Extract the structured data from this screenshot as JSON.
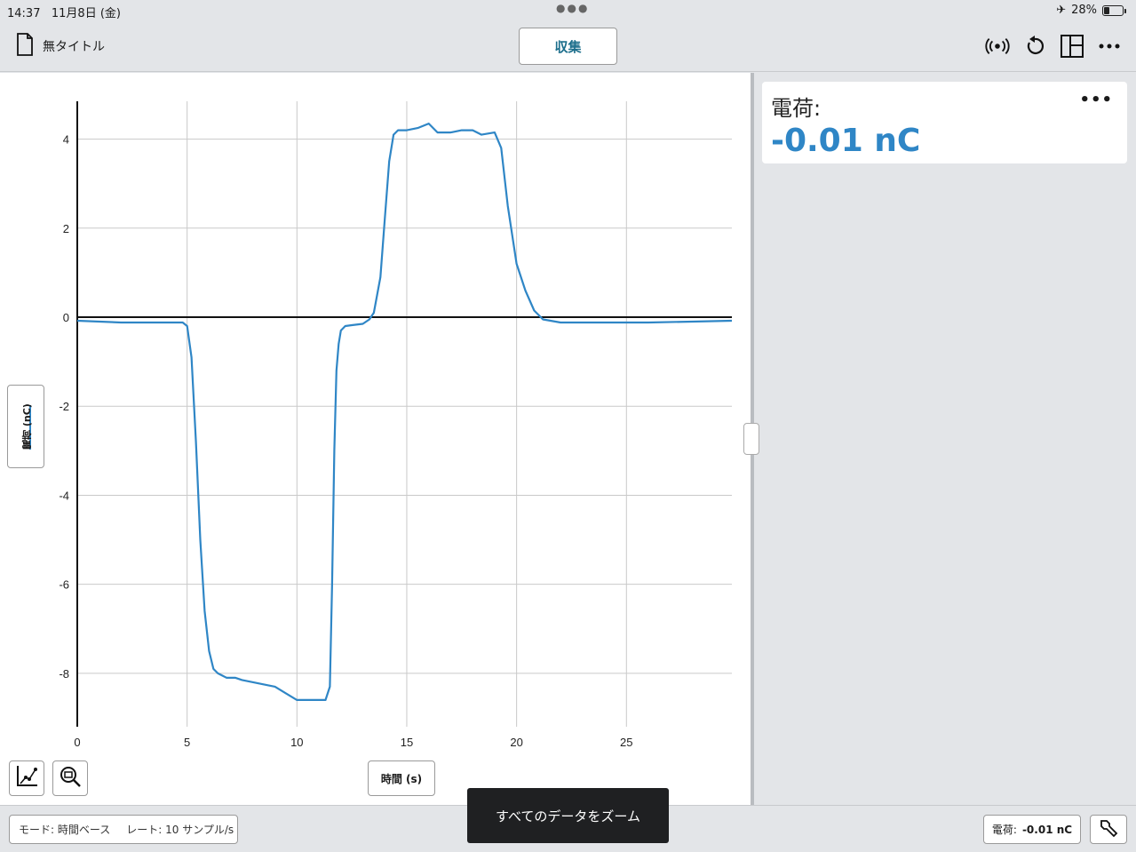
{
  "status": {
    "time": "14:37",
    "date": "11月8日 (金)",
    "battery": "28%",
    "battery_level": 0.28
  },
  "toolbar": {
    "doc_title": "無タイトル",
    "collect_label": "収集"
  },
  "graph": {
    "y_axis_label": "電荷 (nC)",
    "x_axis_label": "時間 (s)",
    "chart_data": {
      "type": "line",
      "xlabel": "時間 (s)",
      "ylabel": "電荷 (nC)",
      "xlim": [
        0,
        29.8
      ],
      "ylim": [
        -9.2,
        4.85
      ],
      "xticks": [
        0,
        5,
        10,
        15,
        20,
        25
      ],
      "yticks": [
        -8,
        -6,
        -4,
        -2,
        0,
        2,
        4
      ],
      "grid": true,
      "series": [
        {
          "color": "#2f86c6",
          "x": [
            0,
            2,
            4,
            4.8,
            5.0,
            5.2,
            5.4,
            5.6,
            5.8,
            6.0,
            6.2,
            6.4,
            6.6,
            6.8,
            7.0,
            7.2,
            7.5,
            8.0,
            8.5,
            9.0,
            9.5,
            10.0,
            10.5,
            11.0,
            11.3,
            11.5,
            11.6,
            11.7,
            11.8,
            11.9,
            12.0,
            12.2,
            12.5,
            13.0,
            13.3,
            13.5,
            13.8,
            14.0,
            14.2,
            14.4,
            14.6,
            15.0,
            15.5,
            16.0,
            16.4,
            17.0,
            17.5,
            18.0,
            18.4,
            19.0,
            19.3,
            19.6,
            20.0,
            20.4,
            20.8,
            21.2,
            22.0,
            24,
            26,
            28,
            29.8
          ],
          "y": [
            -0.08,
            -0.12,
            -0.12,
            -0.12,
            -0.2,
            -0.9,
            -2.8,
            -5.0,
            -6.6,
            -7.5,
            -7.9,
            -8.0,
            -8.05,
            -8.1,
            -8.1,
            -8.1,
            -8.15,
            -8.2,
            -8.25,
            -8.3,
            -8.45,
            -8.6,
            -8.6,
            -8.6,
            -8.6,
            -8.3,
            -6.0,
            -3.0,
            -1.2,
            -0.6,
            -0.3,
            -0.2,
            -0.18,
            -0.15,
            -0.05,
            0.1,
            0.9,
            2.2,
            3.5,
            4.1,
            4.2,
            4.2,
            4.25,
            4.35,
            4.15,
            4.15,
            4.2,
            4.2,
            4.1,
            4.15,
            3.8,
            2.5,
            1.2,
            0.6,
            0.15,
            -0.05,
            -0.12,
            -0.12,
            -0.12,
            -0.1,
            -0.08
          ]
        }
      ]
    }
  },
  "meter": {
    "name": "電荷:",
    "value": "-0.01 nC"
  },
  "bottom": {
    "mode": "モード: 時間ベース",
    "rate": "レート: 10 サンプル/s",
    "readout_label": "電荷:",
    "readout_value": "-0.01 nC",
    "toast": "すべてのデータをズーム"
  },
  "icons": {
    "doc": "document-icon",
    "sensor": "wireless-sensor-icon",
    "undo": "undo-icon",
    "layout": "layout-icon",
    "more": "more-icon",
    "graph_tools": "graph-tools-icon",
    "zoom": "zoom-icon",
    "wrench": "tool-icon",
    "airplane": "airplane-icon"
  }
}
